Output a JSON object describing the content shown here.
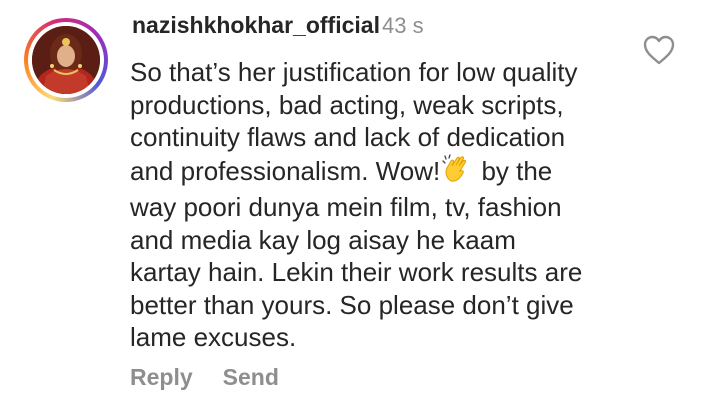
{
  "comment": {
    "username": "nazishkhokhar_official",
    "timestamp": "43 s",
    "lines": [
      "So that’s her justification for low quality",
      "productions, bad acting, weak scripts,",
      "continuity flaws and lack of dedication",
      "and professionalism. Wow!",
      " by the",
      "way poori dunya mein film, tv, fashion",
      "and media kay log aisay he kaam",
      "kartay hain. Lekin their work results are",
      "better than yours. So please don’t give",
      "lame excuses."
    ],
    "emoji_icon": "clapping-hands-icon",
    "like_icon": "heart-outline-icon"
  },
  "actions": {
    "reply_label": "Reply",
    "send_label": "Send"
  },
  "colors": {
    "text": "#262626",
    "secondary": "#8e8e8e",
    "background": "#ffffff"
  }
}
